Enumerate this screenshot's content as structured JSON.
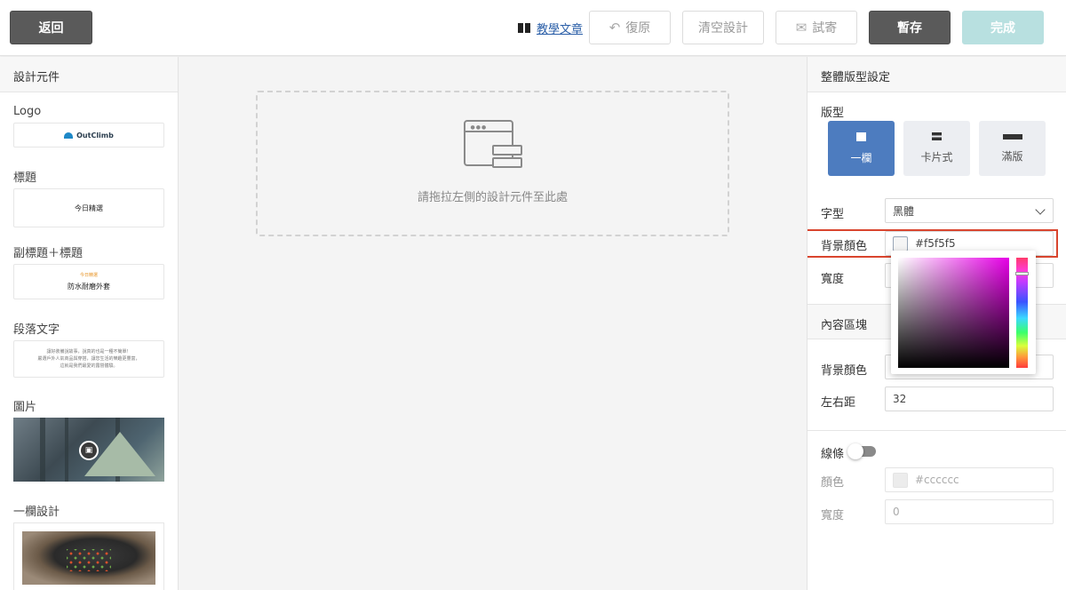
{
  "topbar": {
    "back_label": "返回",
    "tutorial_label": "教學文章",
    "undo_label": "復原",
    "clear_label": "清空設計",
    "send_label": "試寄",
    "save_label": "暫存",
    "done_label": "完成"
  },
  "left_panel": {
    "title": "設計元件",
    "components": {
      "logo_label": "Logo",
      "logo_text": "OutClimb",
      "title_label": "標題",
      "title_sample": "今日精選",
      "subtitle_label": "副標題＋標題",
      "subtitle_sample_small": "今日精選",
      "subtitle_sample_main": "防水耐磨外套",
      "paragraph_label": "段落文字",
      "paragraph_line1": "讓好裝備說故事，說真的也是一種不簡單！",
      "paragraph_line2": "嚴選戶外人氣商品與穿搭，讓您生活的樂趣更豐富，",
      "paragraph_line3": "這就是我們最愛的露營體驗。",
      "image_label": "圖片",
      "one_column_label": "一欄設計"
    }
  },
  "canvas": {
    "drop_hint": "請拖拉左側的設計元件至此處"
  },
  "right_panel": {
    "title": "整體版型設定",
    "layout_label": "版型",
    "layouts": [
      "一欄",
      "卡片式",
      "滿版"
    ],
    "font_label": "字型",
    "font_value": "黑體",
    "bg_color_label": "背景顏色",
    "bg_color_value": "#f5f5f5",
    "width_label": "寬度",
    "content_section_title": "內容區塊",
    "content_bg_label": "背景顏色",
    "padding_label": "左右距",
    "padding_value": "32",
    "line_label": "線條",
    "line_color_label": "顏色",
    "line_color_placeholder": "#cccccc",
    "line_width_label": "寬度",
    "line_width_placeholder": "0"
  },
  "colors": {
    "accent_blue": "#4d7cbf",
    "highlight_red": "#d9452e",
    "done_disabled": "#b8e0e0",
    "dark_button": "#5a5a5a"
  },
  "icons": {
    "undo": "undo-arrow-icon",
    "send": "envelope-icon",
    "tutorial": "book-icon",
    "dropzone": "layout-window-icon"
  }
}
